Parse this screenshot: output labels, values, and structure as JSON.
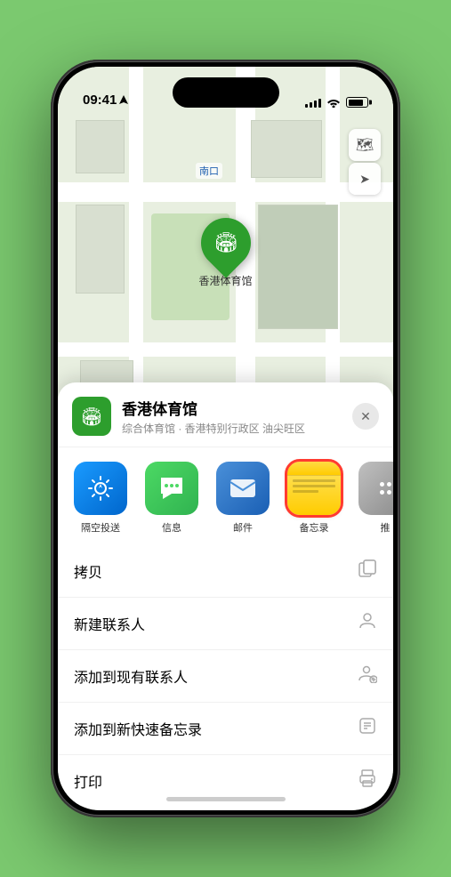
{
  "phone": {
    "status_bar": {
      "time": "09:41",
      "location_arrow": "▶"
    }
  },
  "map": {
    "label": "南口",
    "controls": {
      "layers_icon": "🗺",
      "location_icon": "➤"
    }
  },
  "location_pin": {
    "label": "香港体育馆",
    "icon": "🏟"
  },
  "sheet": {
    "venue_icon": "🏟",
    "venue_name": "香港体育馆",
    "venue_desc": "综合体育馆 · 香港特别行政区 油尖旺区",
    "close_label": "✕",
    "share_items": [
      {
        "id": "airdrop",
        "label": "隔空投送"
      },
      {
        "id": "messages",
        "label": "信息"
      },
      {
        "id": "mail",
        "label": "邮件"
      },
      {
        "id": "notes",
        "label": "备忘录",
        "selected": true
      },
      {
        "id": "more",
        "label": "推"
      }
    ],
    "action_items": [
      {
        "label": "拷贝",
        "icon": "copy"
      },
      {
        "label": "新建联系人",
        "icon": "person"
      },
      {
        "label": "添加到现有联系人",
        "icon": "person-add"
      },
      {
        "label": "添加到新快速备忘录",
        "icon": "quick-note"
      },
      {
        "label": "打印",
        "icon": "print"
      }
    ],
    "more_dots": [
      {
        "color": "#ff3b30"
      },
      {
        "color": "#ff9500"
      },
      {
        "color": "#34c759"
      }
    ]
  }
}
